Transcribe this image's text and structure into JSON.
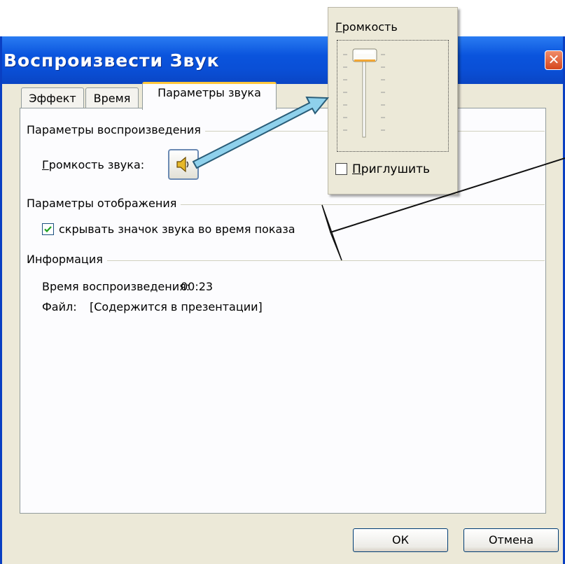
{
  "dialog": {
    "title": "Воспроизвести Звук",
    "close_glyph": "✕"
  },
  "tabs": [
    {
      "label": "Эффект",
      "active": false
    },
    {
      "label": "Время",
      "active": false
    },
    {
      "label": "Параметры звука",
      "active": true
    }
  ],
  "playback": {
    "group_label": "Параметры воспроизведения",
    "volume_label": "Громкость звука:",
    "volume_button_icon": "speaker-icon"
  },
  "display": {
    "group_label": "Параметры отображения",
    "hide_icon_label": "скрывать значок звука во время показа",
    "hide_icon_checked": true
  },
  "info": {
    "group_label": "Информация",
    "duration_label": "Время воспроизведения:",
    "duration_value": "00:23",
    "file_label": "Файл:",
    "file_value": "[Содержится в презентации]"
  },
  "buttons": {
    "ok_label": "ОК",
    "cancel_label": "Отмена"
  },
  "volume_popup": {
    "title": "Громкость",
    "volume_level_fraction": 1.0,
    "mute_label": "Приглушить",
    "mute_checked": false
  },
  "colors": {
    "titlebar": "#0a54dd",
    "window_bg": "#ece9d8",
    "active_tab_accent": "#ffc73c",
    "arrow_fill": "#8fd1ec"
  }
}
